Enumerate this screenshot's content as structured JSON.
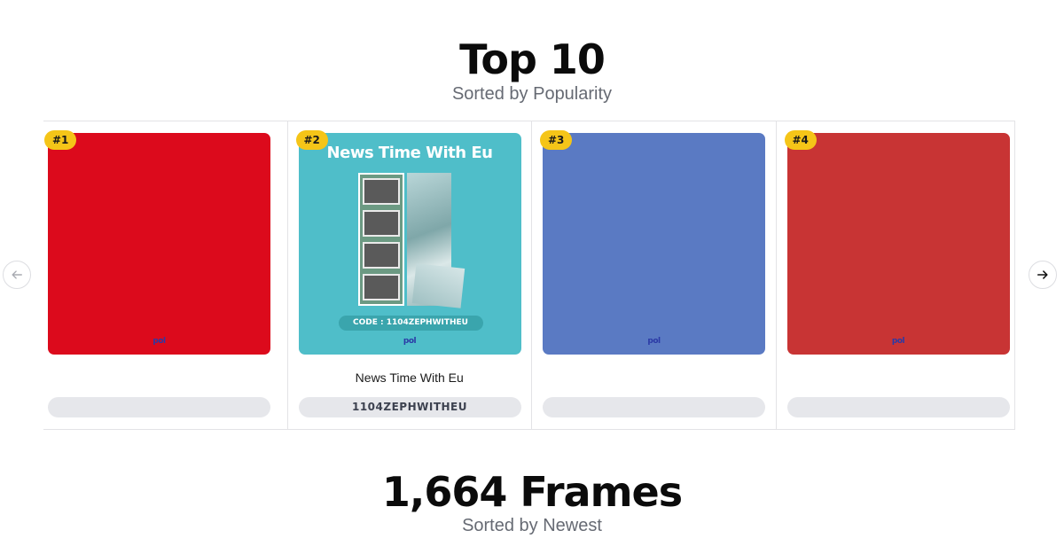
{
  "top_section": {
    "title": "Top 10",
    "subtitle": "Sorted by Popularity"
  },
  "carousel": {
    "cards": [
      {
        "rank": "#1",
        "name": "",
        "code": "",
        "thumb_color": "#dc0a1c",
        "logo": "pol"
      },
      {
        "rank": "#2",
        "name": "News Time With Eu",
        "code": "1104ZEPHWITHEU",
        "thumb_color": "#4fbec9",
        "art_title": "News Time With Eu",
        "art_code": "CODE : 1104ZEPHWITHEU",
        "logo": "pol"
      },
      {
        "rank": "#3",
        "name": "",
        "code": "",
        "thumb_color": "#5a7ac3",
        "logo": "pol"
      },
      {
        "rank": "#4",
        "name": "",
        "code": "",
        "thumb_color": "#c83434",
        "logo": "pol"
      }
    ],
    "prev_icon": "arrow-left-icon",
    "next_icon": "arrow-right-icon"
  },
  "frames_section": {
    "title": "1,664 Frames",
    "subtitle": "Sorted by Newest"
  }
}
